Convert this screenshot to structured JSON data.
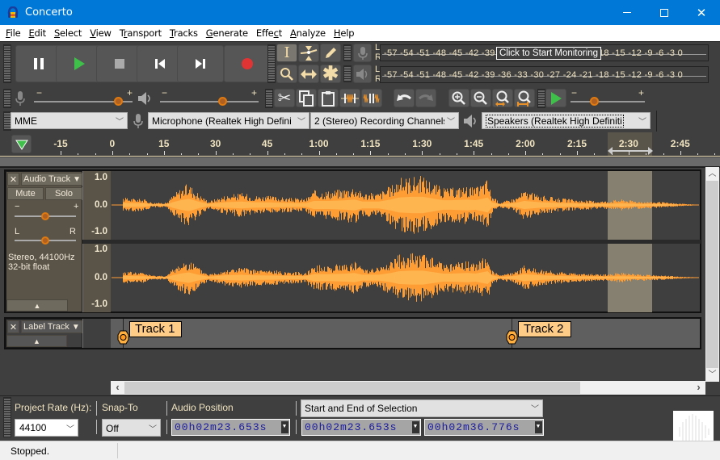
{
  "window": {
    "title": "Concerto",
    "minimize_icon": "minimize-icon",
    "maximize_icon": "maximize-icon",
    "close_icon": "close-icon"
  },
  "menu": [
    {
      "label": "File",
      "u": "F",
      "rest": "ile"
    },
    {
      "label": "Edit",
      "u": "E",
      "rest": "dit"
    },
    {
      "label": "Select",
      "u": "S",
      "rest": "elect"
    },
    {
      "label": "View",
      "u": "V",
      "rest": "iew"
    },
    {
      "label": "Transport",
      "pre": "T",
      "u": "r",
      "rest": "ansport"
    },
    {
      "label": "Tracks",
      "u": "T",
      "rest": "racks"
    },
    {
      "label": "Generate",
      "u": "G",
      "rest": "enerate"
    },
    {
      "label": "Effect",
      "pre": "Effe",
      "u": "c",
      "rest": "t"
    },
    {
      "label": "Analyze",
      "u": "A",
      "rest": "nalyze"
    },
    {
      "label": "Help",
      "u": "H",
      "rest": "elp"
    }
  ],
  "transport": {
    "pause": "pause-icon",
    "play": "play-icon",
    "stop": "stop-icon",
    "skip_start": "skip-to-start-icon",
    "skip_end": "skip-to-end-icon",
    "record": "record-icon"
  },
  "meters": {
    "record_scale": "-57 -54 -51 -48 -45 -42 -39 -36 -33 -30 -27 -24 -21 -18 -15 -12 -9 -6 -3 0",
    "playback_scale": "-57 -54 -51 -48 -45 -42 -39 -36 -33 -30 -27 -24 -21 -18 -15 -12 -9 -6 -3 0",
    "channel_L": "L",
    "channel_R": "R",
    "monitor_tooltip": "Click to Start Monitoring"
  },
  "mixer": {
    "minus": "−",
    "plus": "+",
    "record_volume": 0.88,
    "playback_volume": 0.65
  },
  "play_at_speed": {
    "minus": "−",
    "plus": "+",
    "speed": 0.3
  },
  "devices": {
    "host": "MME",
    "recording_device": "Microphone (Realtek High Defini",
    "channels": "2 (Stereo) Recording Channels",
    "playback_device": "Speakers (Realtek High Definiti"
  },
  "timeline": {
    "ticks": [
      "-15",
      "0",
      "15",
      "30",
      "45",
      "1:00",
      "1:15",
      "1:30",
      "1:45",
      "2:00",
      "2:15",
      "2:30",
      "2:45"
    ]
  },
  "audio_track": {
    "name": "Audio Track",
    "mute": "Mute",
    "solo": "Solo",
    "gain_minus": "−",
    "gain_plus": "+",
    "pan_left": "L",
    "pan_right": "R",
    "gain": 0.5,
    "pan": 0.5,
    "info_line1": "Stereo, 44100Hz",
    "info_line2": "32-bit float",
    "scale_top": "1.0",
    "scale_mid": "0.0",
    "scale_bottom": "-1.0",
    "wave_color": "#ff9d35",
    "wave_rms_color": "#ffb54f",
    "selection_color": "#858070"
  },
  "label_track": {
    "name": "Label Track",
    "labels": [
      {
        "text": "Track 1"
      },
      {
        "text": "Track 2"
      }
    ],
    "label_bg": "#ffcc88"
  },
  "selection_bar": {
    "project_rate_label": "Project Rate (Hz):",
    "project_rate": "44100",
    "snap_label": "Snap-To",
    "snap_value": "Off",
    "audio_position_label": "Audio Position",
    "audio_position": "00h02m23.653s",
    "selection_mode": "Start and End of Selection",
    "selection_start": "00h02m23.653s",
    "selection_end": "00h02m36.776s"
  },
  "status": {
    "text": "Stopped."
  }
}
